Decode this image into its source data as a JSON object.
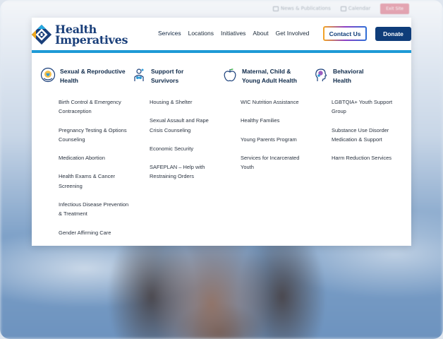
{
  "utility": {
    "news_label": "News & Publications",
    "calendar_label": "Calendar",
    "exit_label": "Exit Site"
  },
  "logo": {
    "line1": "Health",
    "line2": "Imperatives"
  },
  "nav": {
    "items": [
      "Services",
      "Locations",
      "Initiatives",
      "About",
      "Get Involved"
    ],
    "contact_label": "Contact Us",
    "donate_label": "Donate"
  },
  "colors": {
    "brand_blue": "#0f3d7a",
    "accent_bar": "#1e9ad6",
    "exit_red": "#c8102e"
  },
  "menu": {
    "columns": [
      {
        "icon": "reproductive-health-icon",
        "title_line1": "Sexual & Reproductive",
        "title_line2": "Health",
        "links": [
          "Birth Control & Emergency Contraception",
          "Pregnancy Testing & Options Counseling",
          "Medication Abortion",
          "Health Exams & Cancer Screening",
          "Infectious Disease Prevention & Treatment",
          "Gender Affirming Care"
        ]
      },
      {
        "icon": "survivor-support-icon",
        "title_line1": "Support for",
        "title_line2": "Survivors",
        "links": [
          "Housing & Shelter",
          "Sexual Assault and Rape Crisis Counseling",
          "Economic Security",
          "SAFEPLAN – Help with Restraining Orders"
        ]
      },
      {
        "icon": "apple-icon",
        "title_line1": "Maternal, Child &",
        "title_line2": "Young Adult Health",
        "links": [
          "WIC Nutrition Assistance",
          "Healthy Families",
          "Young Parents Program",
          "Services for Incarcerated Youth"
        ]
      },
      {
        "icon": "behavioral-health-icon",
        "title_line1": "Behavioral",
        "title_line2": "Health",
        "links": [
          "LGBTQIA+ Youth Support Group",
          "Substance Use Disorder Medication & Support",
          "Harm Reduction Services"
        ]
      }
    ]
  }
}
